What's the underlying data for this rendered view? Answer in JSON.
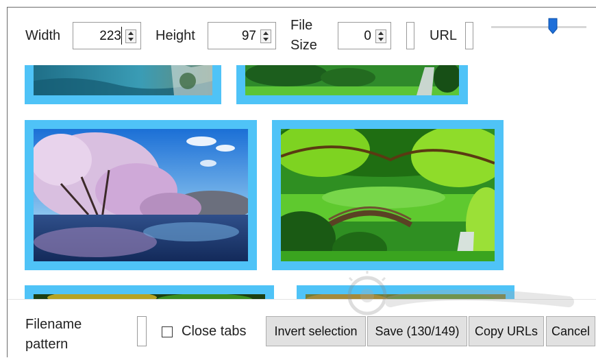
{
  "toolbar": {
    "width_label": "Width",
    "width_value": "223",
    "height_label": "Height",
    "height_value": "97",
    "filesize_label_1": "File",
    "filesize_label_2": "Size",
    "filesize_value": "0",
    "url_label": "URL",
    "size_slider_level": 0.6
  },
  "bottom": {
    "filename_label_1": "Filename",
    "filename_label_2": "pattern",
    "close_tabs_label": "Close tabs",
    "close_tabs_checked": false,
    "invert_label": "Invert selection",
    "save_label": "Save (130/149)",
    "copy_urls_label": "Copy URLs",
    "cancel_label": "Cancel"
  },
  "colors": {
    "selection_border": "#4fc3f7",
    "slider_thumb": "#1e6fd9"
  },
  "images": [
    {
      "subject": "waterfall-lake"
    },
    {
      "subject": "japanese-garden-bridge"
    },
    {
      "subject": "cherry-blossom-lake"
    },
    {
      "subject": "garden-arch-bridge"
    },
    {
      "subject": "forest-canopy"
    },
    {
      "subject": "autumn-garden"
    }
  ]
}
